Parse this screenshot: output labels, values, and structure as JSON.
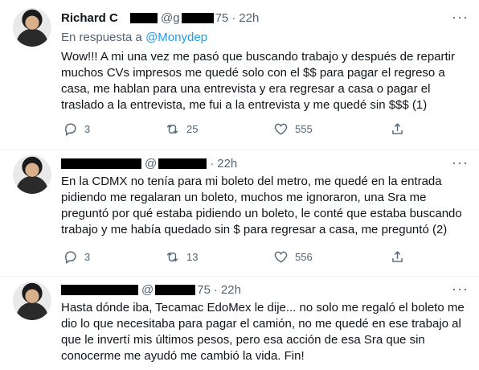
{
  "tweets": [
    {
      "name": "Richard C",
      "handle": "@g",
      "handle_suffix": "75",
      "dot": "·",
      "time": "22h",
      "reply_prefix": "En respuesta a",
      "reply_mention": "@Monydep",
      "text": "Wow!!! A mi una vez me pasó que buscando trabajo y después de repartir muchos CVs impresos me quedé solo con el $$ para pagar el regreso a casa, me hablan para una entrevista y era regresar a casa o pagar el traslado a la entrevista, me fui a la entrevista y me quedé sin $$$ (1)",
      "replies": "3",
      "retweets": "25",
      "likes": "555"
    },
    {
      "handle": "@",
      "dot": "·",
      "time": "22h",
      "text": "En la CDMX no tenía para mi boleto del metro, me quedé en la entrada pidiendo me regalaran un boleto, muchos me ignoraron, una Sra me preguntó por qué estaba pidiendo un boleto, le conté que estaba buscando trabajo y me había quedado sin $ para regresar a casa, me preguntó (2)",
      "replies": "3",
      "retweets": "13",
      "likes": "556"
    },
    {
      "handle": "@",
      "handle_suffix": "75",
      "dot": "·",
      "time": "22h",
      "text": "Hasta dónde iba, Tecamac EdoMex le dije... no solo me regaló el boleto me dio lo que necesitaba para pagar el camión, no me quedé en ese trabajo al que le invertí mis últimos pesos, pero esa acción de esa Sra que sin conocerme me ayudó me cambió la vida. Fin!"
    }
  ],
  "icons": {
    "reply": "reply-icon",
    "retweet": "retweet-icon",
    "like": "heart-icon",
    "share": "share-icon",
    "more": "more-icon"
  },
  "colors": {
    "link": "#1d9bf0",
    "secondary": "#536471",
    "text": "#0f1419"
  }
}
